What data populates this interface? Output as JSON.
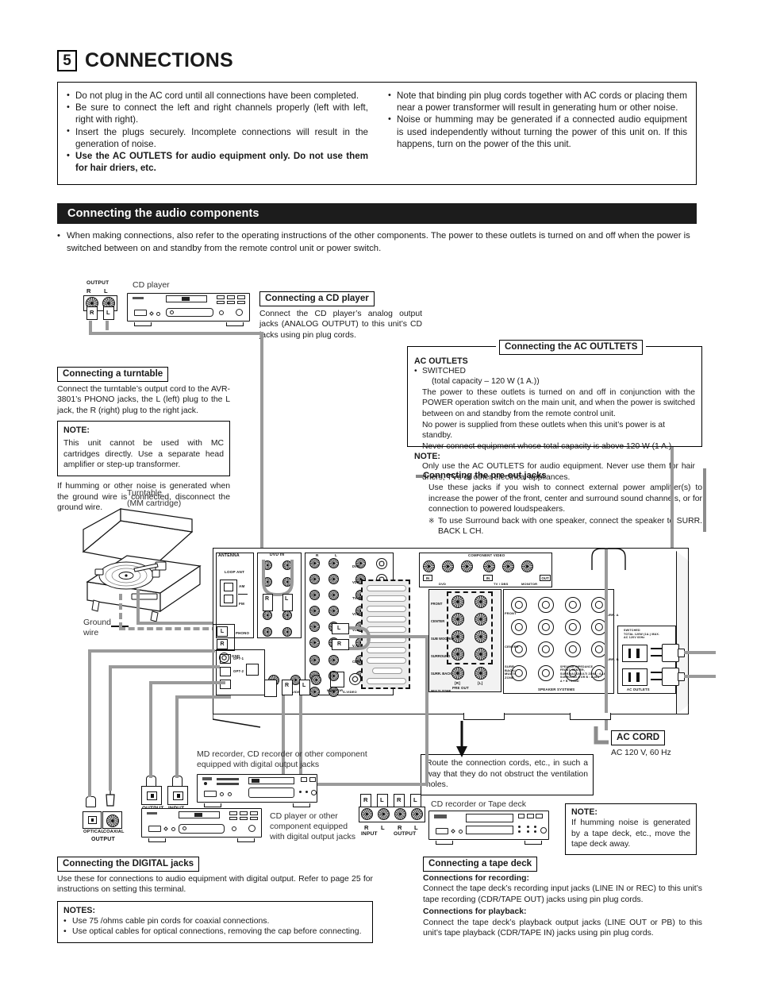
{
  "chapter": {
    "number": "5",
    "title": "CONNECTIONS"
  },
  "caution": {
    "left_items": [
      "Do not plug in the AC cord until all connections have been completed.",
      "Be sure to connect the left and right channels properly (left with left, right with right).",
      "Insert the plugs securely. Incomplete connections will result in the generation of noise.",
      "Use the AC OUTLETS for audio equipment only. Do not use them for hair driers, etc."
    ],
    "right_items": [
      "Note that binding pin plug cords together with AC cords or placing them near a power transformer will result in generating hum or other noise.",
      "Noise or humming may be generated if a connected audio equipment is used independently without turning the power of this unit on. If this happens, turn on the power of the this unit."
    ]
  },
  "section": {
    "bar_title": "Connecting the audio components",
    "intro": "When making connections, also refer to the operating instructions of the other components.\nThe power to these outlets is turned on and off when the power is switched between on and standby from the remote control unit or power switch."
  },
  "cd_player_callout": {
    "title": "Connecting a CD player",
    "body": "Connect the CD player’s analog output jacks (ANALOG OUTPUT) to this unit’s CD jacks using pin plug cords."
  },
  "turntable_callout": {
    "title": "Connecting a turntable",
    "body": "Connect the turntable’s output cord to the AVR-3801’s PHONO jacks, the L (left) plug to the L jack, the R (right) plug to the right jack.",
    "note_label": "NOTE:",
    "note_body": "This unit cannot be used with MC cartridges directly. Use a separate head amplifier or step-up transformer.",
    "after": "If humming or other noise is generated when the ground wire is connected, disconnect the ground wire."
  },
  "ac_outlets_callout": {
    "title": "Connecting the AC OUTLTETS",
    "heading": "AC OUTLETS",
    "switched": "SWITCHED",
    "capacity": "(total capacity – 120 W (1 A.))",
    "para1": "The power to these outlets is turned on and off in conjunction with the POWER operation switch on the main unit, and when the power is switched between on and standby from the remote control unit.",
    "para2": "No power is supplied from these outlets when this unit’s power is at standby.",
    "para3": "Never connect equipment whose total capacity is above 120 W (1 A.).",
    "note_label": "NOTE:",
    "note_body": "Only use the AC OUTLETS for audio equipment. Never use them for hair driers, TVs or other electrical appliances."
  },
  "preout_callout": {
    "title": "Connecting the pre-out jacks",
    "body": "Use these jacks if you wish to connect external power amplifier(s) to increase the power of the front, center and surround sound channels, or for connection to powered loudspeakers.",
    "star_note": "To use Surround back with one speaker, connect the speaker to SURR. BACK L CH."
  },
  "digital_callout": {
    "title": "Connecting the DIGITAL jacks",
    "body": "Use these for connections to audio equipment with digital output. Refer to page 25 for instructions on setting this terminal.",
    "notes_label": "NOTES:",
    "notes": [
      "Use 75  /ohms cable pin cords for coaxial connections.",
      "Use optical cables for optical connections, removing the cap before connecting."
    ]
  },
  "tape_callout": {
    "title": "Connecting a tape deck",
    "rec_label": "Connections for recording:",
    "rec_body": "Connect the tape deck’s recording input jacks (LINE IN or REC) to this unit’s tape recording (CDR/TAPE OUT) jacks using pin plug cords.",
    "pb_label": "Connections for playback:",
    "pb_body": "Connect the tape deck’s playback output jacks (LINE OUT or PB) to this unit’s tape playback (CDR/TAPE IN) jacks using pin plug cords."
  },
  "tape_note": {
    "label": "NOTE:",
    "body": "If humming noise is generated by a tape deck, etc., move the tape deck away."
  },
  "vent_note": {
    "body": "Route the connection cords, etc., in such a way that they do not obstruct the ventilation holes."
  },
  "ac_cord": {
    "title": "AC CORD",
    "spec": "AC 120 V, 60 Hz"
  },
  "device_labels": {
    "cd_player": "CD player",
    "turntable": "Turntable\n(MM cartridge)",
    "ground_wire": "Ground\nwire",
    "md_recorder": "MD recorder, CD recorder or other component equipped with digital output jacks",
    "cd_player2": "CD player or other component equipped with digital output jacks",
    "cd_recorder": "CD recorder or Tape deck"
  },
  "connector_labels": {
    "output": "OUTPUT",
    "r": "R",
    "l": "L",
    "optical": "OPTICAL",
    "coaxial": "COAXIAL",
    "input": "INPUT",
    "opt_output": "OUTPUT",
    "opt_input": "INPUT",
    "tape_in": "INPUT",
    "tape_out": "OUTPUT"
  },
  "rear_panel": {
    "antenna": "ANTENNA",
    "loop_ant": "LOOP ANT",
    "am": "AM",
    "fm": "FM",
    "dvd_in": "DVD IN",
    "phono": "PHONO",
    "gnd": "GND",
    "digital": "DIGITAL",
    "component_video": "COMPONENT VIDEO",
    "pre_out": "PRE OUT",
    "speaker_systems": "SPEAKER SYSTEMS",
    "ac_outlets": "AC OUTLETS",
    "switched": "SWITCHED\nTOTAL 120W (1A.) MAX.\nAC 120V  60Hz",
    "speaker_impedance": "SPEAKER IMPEDANCE\nFRONT, CENTER,\nSURR.BACK/MULTI ZONE : 6-16Ω\nSURROUND    A OR B : 6-16Ω\n                 A + B : 9-16Ω",
    "in": "IN",
    "out": "OUT",
    "monitor": "MONITOR",
    "dvd": "DVD",
    "tv_dbs": "TV / DBS",
    "video": "VIDEO",
    "s_video": "S-VIDEO",
    "channels": [
      "FRONT",
      "CENTER",
      "SUB WOOFER",
      "SURROUND",
      "SURR. BACK",
      "MULTI ZONE"
    ],
    "sources": [
      "DVD",
      "VDP",
      "TV/ DBS",
      "VCR-1",
      "VCR-2/ V.AUX",
      "CDR/ TAPE",
      "VCR-1",
      "VCR-2/ V.AUX",
      "CDR/ TAPE"
    ],
    "comp_y": "Y",
    "comp_cb": "CB",
    "comp_cr": "CR",
    "opt1": "OPT-1",
    "opt2": "OPT-2",
    "speaker_groups": [
      "FRONT",
      "CENTER",
      "SURR. BACK/ MULTI ZONE",
      "SURR. A",
      "SURR. B"
    ],
    "rl": [
      "R",
      "L"
    ]
  },
  "colors": {
    "cable": "#9a9a9a",
    "bar_bg": "#1c1c1c",
    "ink": "#111111"
  }
}
